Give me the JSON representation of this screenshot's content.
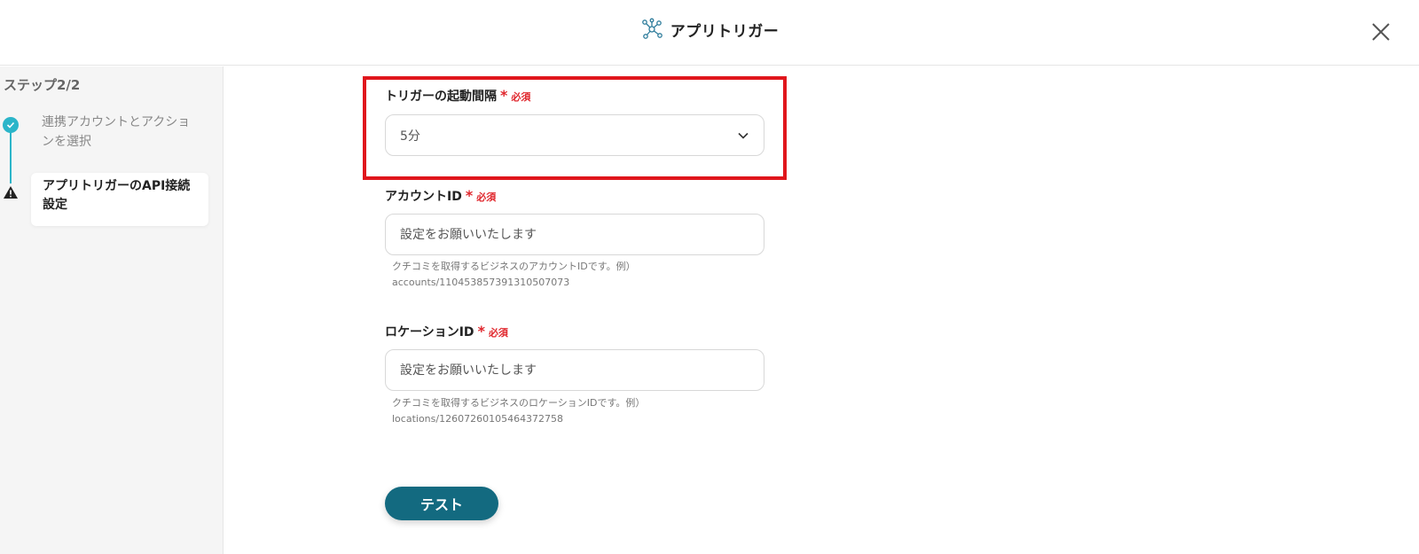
{
  "header": {
    "title": "アプリトリガー",
    "app_icon": "network-nodes-icon",
    "close_icon": "close-icon"
  },
  "sidebar": {
    "step_label": "ステップ2/2",
    "steps": [
      {
        "label": "連携アカウントとアクションを選択",
        "status": "completed",
        "icon": "check-circle-icon"
      },
      {
        "label": "アプリトリガーのAPI接続設定",
        "status": "current-warning",
        "icon": "warning-icon"
      }
    ]
  },
  "form": {
    "interval": {
      "label": "トリガーの起動間隔",
      "asterisk": "*",
      "required": "必須",
      "value": "5分"
    },
    "account_id": {
      "label": "アカウントID",
      "asterisk": "*",
      "required": "必須",
      "placeholder": "設定をお願いいたします",
      "help_line1": "クチコミを取得するビジネスのアカウントIDです。例）",
      "help_line2": "accounts/110453857391310507073"
    },
    "location_id": {
      "label": "ロケーションID",
      "asterisk": "*",
      "required": "必須",
      "placeholder": "設定をお願いいたします",
      "help_line1": "クチコミを取得するビジネスのロケーションIDです。例）",
      "help_line2": "locations/12607260105464372758"
    },
    "test_button": "テスト"
  },
  "colors": {
    "accent_teal": "#2bb5c9",
    "button": "#136a80",
    "required_red": "#e0262c",
    "highlight_red": "#e0161c"
  }
}
